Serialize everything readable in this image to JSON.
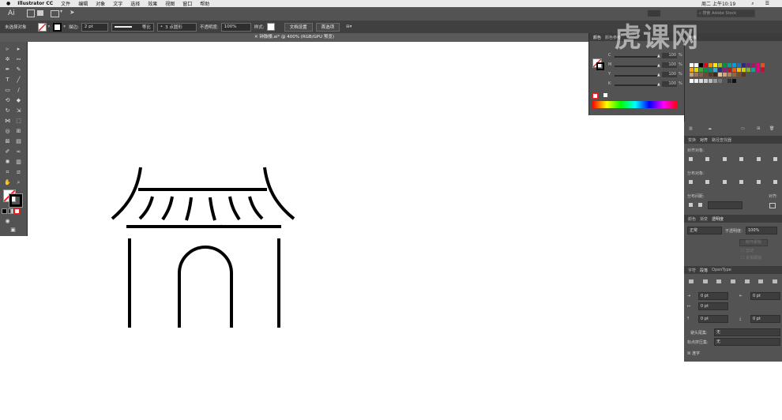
{
  "menubar": {
    "app": "Illustrator CC",
    "items": [
      "文件",
      "编辑",
      "对象",
      "文字",
      "选择",
      "效果",
      "视图",
      "窗口",
      "帮助"
    ],
    "clock": "周二 上午10:19"
  },
  "appbar": {
    "logo": "Ai",
    "search_placeholder": "搜索 Adobe Stock"
  },
  "control": {
    "selection": "未选择对象",
    "stroke_label": "描边:",
    "stroke_value": "2 pt",
    "profile": "等比",
    "brush": "3 点圆形",
    "opacity_label": "不透明度:",
    "opacity_value": "100%",
    "style_label": "样式:",
    "doc_setup": "文档设置",
    "prefs": "首选项"
  },
  "document": {
    "tab_title": "钟鼓楼.ai* @ 400% (RGB/GPU 预览)"
  },
  "color_panel": {
    "tabs": [
      "颜色",
      "颜色参考"
    ],
    "channels": [
      {
        "label": "C",
        "value": "100"
      },
      {
        "label": "M",
        "value": "100"
      },
      {
        "label": "Y",
        "value": "100"
      },
      {
        "label": "K",
        "value": "100"
      }
    ],
    "unit": "%"
  },
  "swatch_panel": {
    "tab": "色板"
  },
  "align_panel": {
    "tabs": [
      "变换",
      "对齐",
      "路径查找器"
    ],
    "align_objects": "对齐对象:",
    "distribute_objects": "分布对象:",
    "distribute_spacing": "分布间距:",
    "align_to": "对齐:"
  },
  "transparency_panel": {
    "tabs": [
      "颜色",
      "渐变",
      "透明度"
    ],
    "blend_mode": "正常",
    "opacity_label": "不透明度:",
    "opacity_value": "100%",
    "make_mask": "制作蒙版",
    "clip": "剪切",
    "invert_mask": "反相蒙版"
  },
  "paragraph_panel": {
    "tabs": [
      "字符",
      "段落",
      "OpenType"
    ],
    "left_indent": "0 pt",
    "right_indent": "0 pt",
    "first_indent": "0 pt",
    "space_before": "0 pt",
    "space_after": "0 pt",
    "hyphen_label": "避头尾集:",
    "hyphen_value": "无",
    "punct_label": "标点挤压集:",
    "punct_value": "无",
    "hyphenation": "连字"
  },
  "watermark": "虎课网",
  "colors": {
    "panel": "#535353",
    "dark": "#404040",
    "menubar": "#e9e9e9"
  }
}
